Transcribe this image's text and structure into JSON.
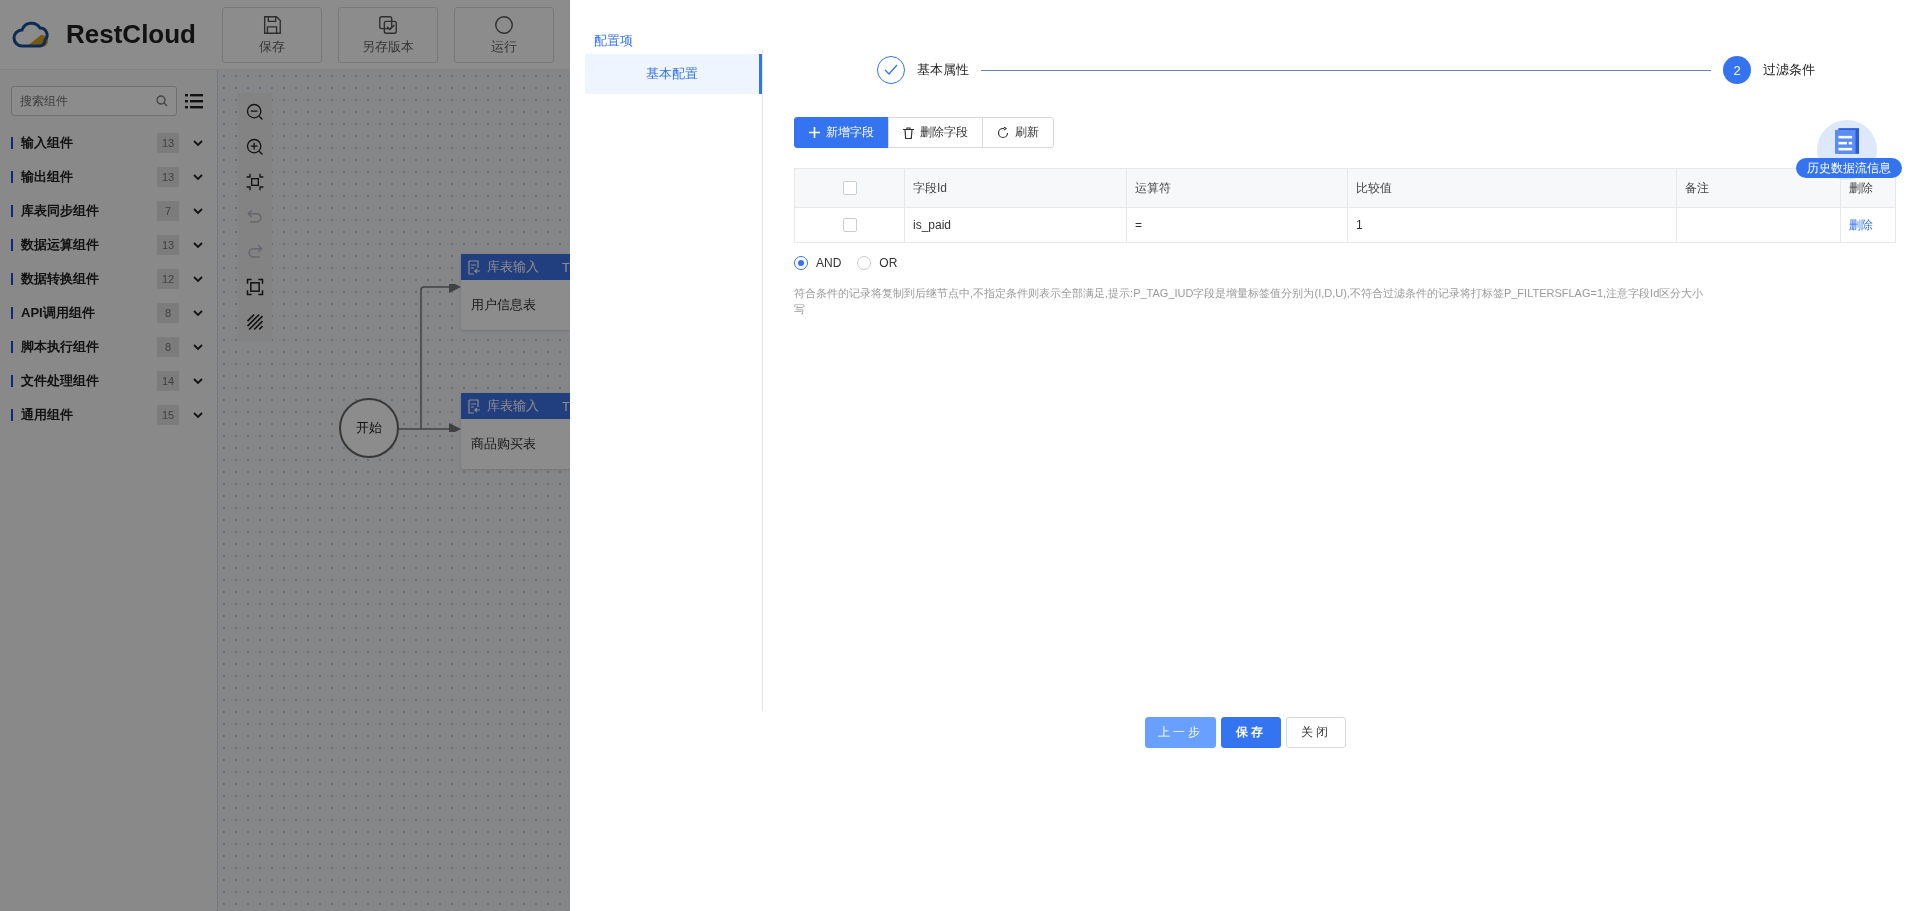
{
  "app": {
    "logo": "RestCloud",
    "toolbar": [
      {
        "label": "保存"
      },
      {
        "label": "另存版本"
      },
      {
        "label": "运行"
      }
    ]
  },
  "sidebar": {
    "search_placeholder": "搜索组件",
    "groups": [
      {
        "label": "输入组件",
        "count": "13"
      },
      {
        "label": "输出组件",
        "count": "13"
      },
      {
        "label": "库表同步组件",
        "count": "7"
      },
      {
        "label": "数据运算组件",
        "count": "13"
      },
      {
        "label": "数据转换组件",
        "count": "12"
      },
      {
        "label": "API调用组件",
        "count": "8"
      },
      {
        "label": "脚本执行组件",
        "count": "8"
      },
      {
        "label": "文件处理组件",
        "count": "14"
      },
      {
        "label": "通用组件",
        "count": "15"
      }
    ]
  },
  "canvas": {
    "tools": [
      {
        "kind": "zoom-out",
        "disabled": false
      },
      {
        "kind": "zoom-in",
        "disabled": false
      },
      {
        "kind": "fit",
        "disabled": false
      },
      {
        "kind": "undo",
        "disabled": true
      },
      {
        "kind": "redo",
        "disabled": true
      },
      {
        "kind": "frame",
        "disabled": false
      },
      {
        "kind": "hatch",
        "disabled": false
      }
    ],
    "start": "开始",
    "nodes": [
      {
        "type": "库表输入",
        "tail": "T",
        "name": "用户信息表"
      },
      {
        "type": "库表输入",
        "tail": "T",
        "name": "商品购买表"
      }
    ]
  },
  "drawer": {
    "menu_title": "配置项",
    "menu": [
      {
        "label": "基本配置",
        "selected": true
      }
    ],
    "steps": [
      {
        "label": "基本属性",
        "done": true
      },
      {
        "label": "过滤条件",
        "done": false,
        "number": "2"
      }
    ],
    "actions": [
      {
        "label": "新增字段",
        "kind": "add"
      },
      {
        "label": "删除字段",
        "kind": "delete"
      },
      {
        "label": "刷新",
        "kind": "refresh"
      }
    ],
    "table": {
      "header_checked": false,
      "columns": [
        "字段Id",
        "运算符",
        "比较值",
        "备注",
        "删除"
      ],
      "rows": [
        {
          "checked": false,
          "field_id": "is_paid",
          "operator": "=",
          "value": "1",
          "action": "删除"
        }
      ]
    },
    "logic": [
      {
        "label": "AND",
        "selected": true
      },
      {
        "label": "OR",
        "selected": false
      }
    ],
    "note": "符合条件的记录将复制到后继节点中,不指定条件则表示全部满足,提示:P_TAG_IUD字段是增量标签值分别为(I,D,U),不符合过滤条件的记录将打标签P_FILTERSFLAG=1,注意字段Id区分大小写",
    "history_badge": "历史数据流信息",
    "footer": [
      {
        "label": "上一步",
        "kind": "prev"
      },
      {
        "label": "保存",
        "kind": "primary"
      },
      {
        "label": "关闭",
        "kind": "default"
      }
    ]
  }
}
